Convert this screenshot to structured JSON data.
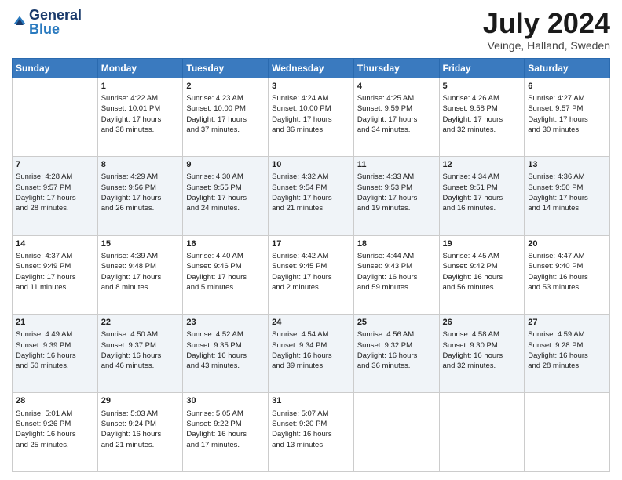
{
  "header": {
    "logo_general": "General",
    "logo_blue": "Blue",
    "month_title": "July 2024",
    "location": "Veinge, Halland, Sweden"
  },
  "days_of_week": [
    "Sunday",
    "Monday",
    "Tuesday",
    "Wednesday",
    "Thursday",
    "Friday",
    "Saturday"
  ],
  "weeks": [
    [
      {
        "day": "",
        "info": ""
      },
      {
        "day": "1",
        "info": "Sunrise: 4:22 AM\nSunset: 10:01 PM\nDaylight: 17 hours\nand 38 minutes."
      },
      {
        "day": "2",
        "info": "Sunrise: 4:23 AM\nSunset: 10:00 PM\nDaylight: 17 hours\nand 37 minutes."
      },
      {
        "day": "3",
        "info": "Sunrise: 4:24 AM\nSunset: 10:00 PM\nDaylight: 17 hours\nand 36 minutes."
      },
      {
        "day": "4",
        "info": "Sunrise: 4:25 AM\nSunset: 9:59 PM\nDaylight: 17 hours\nand 34 minutes."
      },
      {
        "day": "5",
        "info": "Sunrise: 4:26 AM\nSunset: 9:58 PM\nDaylight: 17 hours\nand 32 minutes."
      },
      {
        "day": "6",
        "info": "Sunrise: 4:27 AM\nSunset: 9:57 PM\nDaylight: 17 hours\nand 30 minutes."
      }
    ],
    [
      {
        "day": "7",
        "info": "Sunrise: 4:28 AM\nSunset: 9:57 PM\nDaylight: 17 hours\nand 28 minutes."
      },
      {
        "day": "8",
        "info": "Sunrise: 4:29 AM\nSunset: 9:56 PM\nDaylight: 17 hours\nand 26 minutes."
      },
      {
        "day": "9",
        "info": "Sunrise: 4:30 AM\nSunset: 9:55 PM\nDaylight: 17 hours\nand 24 minutes."
      },
      {
        "day": "10",
        "info": "Sunrise: 4:32 AM\nSunset: 9:54 PM\nDaylight: 17 hours\nand 21 minutes."
      },
      {
        "day": "11",
        "info": "Sunrise: 4:33 AM\nSunset: 9:53 PM\nDaylight: 17 hours\nand 19 minutes."
      },
      {
        "day": "12",
        "info": "Sunrise: 4:34 AM\nSunset: 9:51 PM\nDaylight: 17 hours\nand 16 minutes."
      },
      {
        "day": "13",
        "info": "Sunrise: 4:36 AM\nSunset: 9:50 PM\nDaylight: 17 hours\nand 14 minutes."
      }
    ],
    [
      {
        "day": "14",
        "info": "Sunrise: 4:37 AM\nSunset: 9:49 PM\nDaylight: 17 hours\nand 11 minutes."
      },
      {
        "day": "15",
        "info": "Sunrise: 4:39 AM\nSunset: 9:48 PM\nDaylight: 17 hours\nand 8 minutes."
      },
      {
        "day": "16",
        "info": "Sunrise: 4:40 AM\nSunset: 9:46 PM\nDaylight: 17 hours\nand 5 minutes."
      },
      {
        "day": "17",
        "info": "Sunrise: 4:42 AM\nSunset: 9:45 PM\nDaylight: 17 hours\nand 2 minutes."
      },
      {
        "day": "18",
        "info": "Sunrise: 4:44 AM\nSunset: 9:43 PM\nDaylight: 16 hours\nand 59 minutes."
      },
      {
        "day": "19",
        "info": "Sunrise: 4:45 AM\nSunset: 9:42 PM\nDaylight: 16 hours\nand 56 minutes."
      },
      {
        "day": "20",
        "info": "Sunrise: 4:47 AM\nSunset: 9:40 PM\nDaylight: 16 hours\nand 53 minutes."
      }
    ],
    [
      {
        "day": "21",
        "info": "Sunrise: 4:49 AM\nSunset: 9:39 PM\nDaylight: 16 hours\nand 50 minutes."
      },
      {
        "day": "22",
        "info": "Sunrise: 4:50 AM\nSunset: 9:37 PM\nDaylight: 16 hours\nand 46 minutes."
      },
      {
        "day": "23",
        "info": "Sunrise: 4:52 AM\nSunset: 9:35 PM\nDaylight: 16 hours\nand 43 minutes."
      },
      {
        "day": "24",
        "info": "Sunrise: 4:54 AM\nSunset: 9:34 PM\nDaylight: 16 hours\nand 39 minutes."
      },
      {
        "day": "25",
        "info": "Sunrise: 4:56 AM\nSunset: 9:32 PM\nDaylight: 16 hours\nand 36 minutes."
      },
      {
        "day": "26",
        "info": "Sunrise: 4:58 AM\nSunset: 9:30 PM\nDaylight: 16 hours\nand 32 minutes."
      },
      {
        "day": "27",
        "info": "Sunrise: 4:59 AM\nSunset: 9:28 PM\nDaylight: 16 hours\nand 28 minutes."
      }
    ],
    [
      {
        "day": "28",
        "info": "Sunrise: 5:01 AM\nSunset: 9:26 PM\nDaylight: 16 hours\nand 25 minutes."
      },
      {
        "day": "29",
        "info": "Sunrise: 5:03 AM\nSunset: 9:24 PM\nDaylight: 16 hours\nand 21 minutes."
      },
      {
        "day": "30",
        "info": "Sunrise: 5:05 AM\nSunset: 9:22 PM\nDaylight: 16 hours\nand 17 minutes."
      },
      {
        "day": "31",
        "info": "Sunrise: 5:07 AM\nSunset: 9:20 PM\nDaylight: 16 hours\nand 13 minutes."
      },
      {
        "day": "",
        "info": ""
      },
      {
        "day": "",
        "info": ""
      },
      {
        "day": "",
        "info": ""
      }
    ]
  ]
}
